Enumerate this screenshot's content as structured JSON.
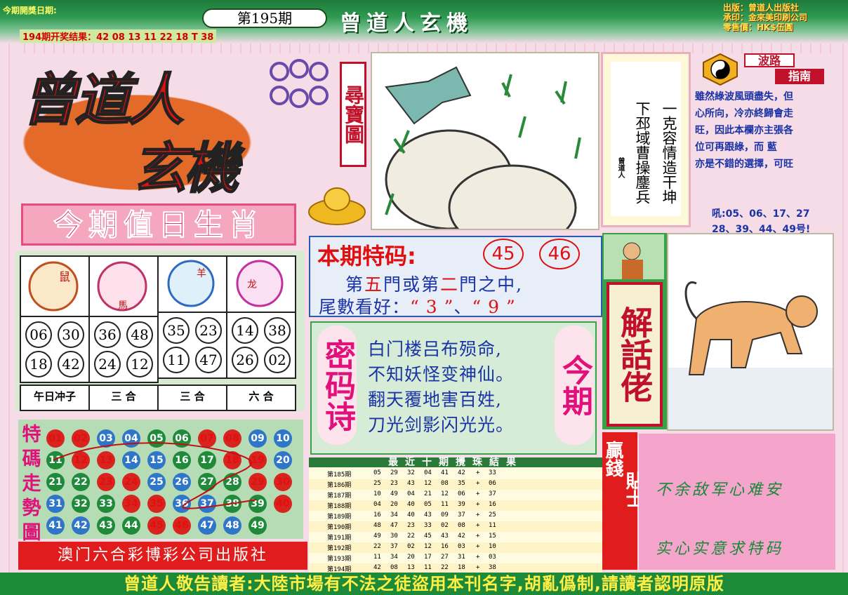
{
  "header": {
    "open_date_label": "今期開獎日期:",
    "last_result": "194期开奖结果：42 08 13 11 22 18 T 38",
    "issue": "第195期",
    "masthead": "曾道人玄機",
    "publisher_lines": [
      "出版：曾道人出版社",
      "承印：金來美印刷公司",
      "零售價：HK$伍圓"
    ]
  },
  "logo": {
    "line1": "曾道人",
    "line2": "玄機",
    "seek_label": "尋寶圖"
  },
  "zodiac": {
    "title": "今期值日生肖",
    "animals": [
      {
        "name": "鼠",
        "numbers": [
          "06",
          "30",
          "18",
          "42"
        ],
        "label": "午日冲子"
      },
      {
        "name": "馬",
        "numbers": [
          "36",
          "48",
          "24",
          "12"
        ],
        "label": "三 合"
      },
      {
        "name": "羊",
        "numbers": [
          "35",
          "23",
          "11",
          "47"
        ],
        "label": "三 合"
      },
      {
        "name": "龙",
        "numbers": [
          "14",
          "38",
          "26",
          "02"
        ],
        "label": "六 合"
      }
    ]
  },
  "number_grid": {
    "title": "特碼走勢圖",
    "rows": [
      [
        {
          "n": "01",
          "c": "red"
        },
        {
          "n": "02",
          "c": "red"
        },
        {
          "n": "03",
          "c": "blue"
        },
        {
          "n": "04",
          "c": "blue"
        },
        {
          "n": "05",
          "c": "green"
        },
        {
          "n": "06",
          "c": "green"
        },
        {
          "n": "07",
          "c": "red"
        },
        {
          "n": "08",
          "c": "red"
        },
        {
          "n": "09",
          "c": "blue"
        },
        {
          "n": "10",
          "c": "blue"
        }
      ],
      [
        {
          "n": "11",
          "c": "green"
        },
        {
          "n": "12",
          "c": "red"
        },
        {
          "n": "13",
          "c": "red"
        },
        {
          "n": "14",
          "c": "blue"
        },
        {
          "n": "15",
          "c": "blue"
        },
        {
          "n": "16",
          "c": "green"
        },
        {
          "n": "17",
          "c": "green"
        },
        {
          "n": "18",
          "c": "red"
        },
        {
          "n": "19",
          "c": "red"
        },
        {
          "n": "20",
          "c": "blue"
        }
      ],
      [
        {
          "n": "21",
          "c": "green"
        },
        {
          "n": "22",
          "c": "green"
        },
        {
          "n": "23",
          "c": "red"
        },
        {
          "n": "24",
          "c": "red"
        },
        {
          "n": "25",
          "c": "blue"
        },
        {
          "n": "26",
          "c": "blue"
        },
        {
          "n": "27",
          "c": "green"
        },
        {
          "n": "28",
          "c": "green"
        },
        {
          "n": "29",
          "c": "red"
        },
        {
          "n": "30",
          "c": "red"
        }
      ],
      [
        {
          "n": "31",
          "c": "blue"
        },
        {
          "n": "32",
          "c": "green"
        },
        {
          "n": "33",
          "c": "green"
        },
        {
          "n": "34",
          "c": "red"
        },
        {
          "n": "35",
          "c": "red"
        },
        {
          "n": "36",
          "c": "blue"
        },
        {
          "n": "37",
          "c": "blue"
        },
        {
          "n": "38",
          "c": "green"
        },
        {
          "n": "39",
          "c": "green"
        },
        {
          "n": "40",
          "c": "red"
        }
      ],
      [
        {
          "n": "41",
          "c": "blue"
        },
        {
          "n": "42",
          "c": "blue"
        },
        {
          "n": "43",
          "c": "green"
        },
        {
          "n": "44",
          "c": "green"
        },
        {
          "n": "45",
          "c": "red"
        },
        {
          "n": "46",
          "c": "red"
        },
        {
          "n": "47",
          "c": "blue"
        },
        {
          "n": "48",
          "c": "blue"
        },
        {
          "n": "49",
          "c": "green"
        }
      ]
    ],
    "publisher": "澳门六合彩博彩公司出版社"
  },
  "special_code": {
    "title": "本期特码:",
    "numbers": [
      "45",
      "46"
    ],
    "line1_a": "第",
    "line1_b": "五",
    "line1_c": "門或第",
    "line1_d": "二",
    "line1_e": "門之中,",
    "line2_a": "尾數看好：",
    "line2_b": "“ 3 ”",
    "line2_c": "、",
    "line2_d": "“ 9 ”"
  },
  "poem": {
    "label": "密码诗",
    "issue_label": "今期",
    "lines": [
      "白门楼吕布殒命,",
      "不知妖怪变神仙。",
      "翻天覆地害百姓,",
      "刀光剑影闪光光。"
    ]
  },
  "recent": {
    "title": "最近十期攪珠結果",
    "rows": [
      {
        "p": "第185期",
        "n": [
          "05",
          "29",
          "32",
          "04",
          "41",
          "42"
        ],
        "t": "33"
      },
      {
        "p": "第186期",
        "n": [
          "25",
          "23",
          "43",
          "12",
          "08",
          "35"
        ],
        "t": "06"
      },
      {
        "p": "第187期",
        "n": [
          "10",
          "49",
          "04",
          "21",
          "12",
          "06"
        ],
        "t": "37"
      },
      {
        "p": "第188期",
        "n": [
          "04",
          "20",
          "40",
          "05",
          "11",
          "39"
        ],
        "t": "16"
      },
      {
        "p": "第189期",
        "n": [
          "16",
          "34",
          "40",
          "43",
          "09",
          "37"
        ],
        "t": "25"
      },
      {
        "p": "第190期",
        "n": [
          "48",
          "47",
          "23",
          "33",
          "02",
          "08"
        ],
        "t": "11"
      },
      {
        "p": "第191期",
        "n": [
          "49",
          "30",
          "22",
          "45",
          "43",
          "42"
        ],
        "t": "15"
      },
      {
        "p": "第192期",
        "n": [
          "22",
          "37",
          "02",
          "12",
          "16",
          "03"
        ],
        "t": "10"
      },
      {
        "p": "第193期",
        "n": [
          "11",
          "34",
          "20",
          "17",
          "27",
          "31"
        ],
        "t": "03"
      },
      {
        "p": "第194期",
        "n": [
          "42",
          "08",
          "13",
          "11",
          "22",
          "18"
        ],
        "t": "38"
      }
    ]
  },
  "tip": {
    "poem_right": "一克容情造干坤",
    "poem_left": "下邳域曹操鏖兵",
    "author": "曾道人"
  },
  "guide": {
    "label1": "波路",
    "label2": "指南",
    "lines": [
      "雖然綠波風頭盡失，但",
      "心所向，冷亦終歸會走",
      "旺，因此本欄亦主張各",
      "位可再跟綠，而 藍",
      "亦是不錯的選擇，可旺"
    ],
    "nums_line1": "吼:05、06、17、27",
    "nums_line2": "28、39、44、49号!"
  },
  "decode": {
    "label": "解話佬",
    "win_label1": "贏錢",
    "win_label2": "貼士",
    "line1": "不余敌军心难安",
    "line2": "实心实意求特码"
  },
  "footer": {
    "warning": "曾道人敬告讀者:大陸市場有不法之徒盜用本刊名字,胡亂僞制,請讀者認明原版"
  }
}
